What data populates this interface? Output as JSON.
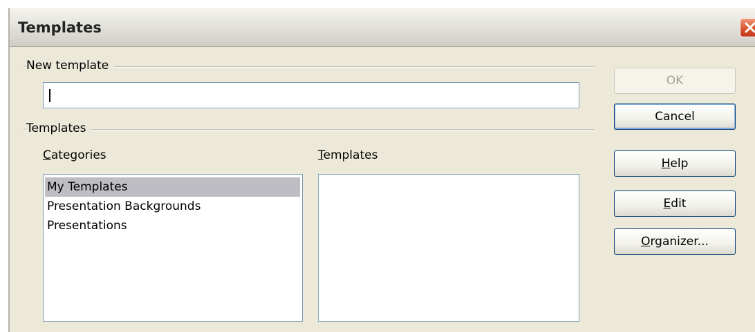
{
  "window": {
    "title": "Templates"
  },
  "new_template": {
    "group_label": "New template",
    "value": "",
    "caret": "|"
  },
  "templates_group": {
    "group_label": "Templates",
    "categories_label": "Categories",
    "templates_label": "Templates",
    "categories": [
      "My Templates",
      "Presentation Backgrounds",
      "Presentations"
    ],
    "selected_category": "My Templates",
    "templates": []
  },
  "buttons": {
    "ok": "OK",
    "cancel": "Cancel",
    "help": "Help",
    "edit": "Edit",
    "organizer": "Organizer..."
  },
  "colors": {
    "dialog_bg": "#ece9d8",
    "selection": "#bdbdc3",
    "close_button": "#d8542d",
    "input_border": "#7f9db9"
  }
}
